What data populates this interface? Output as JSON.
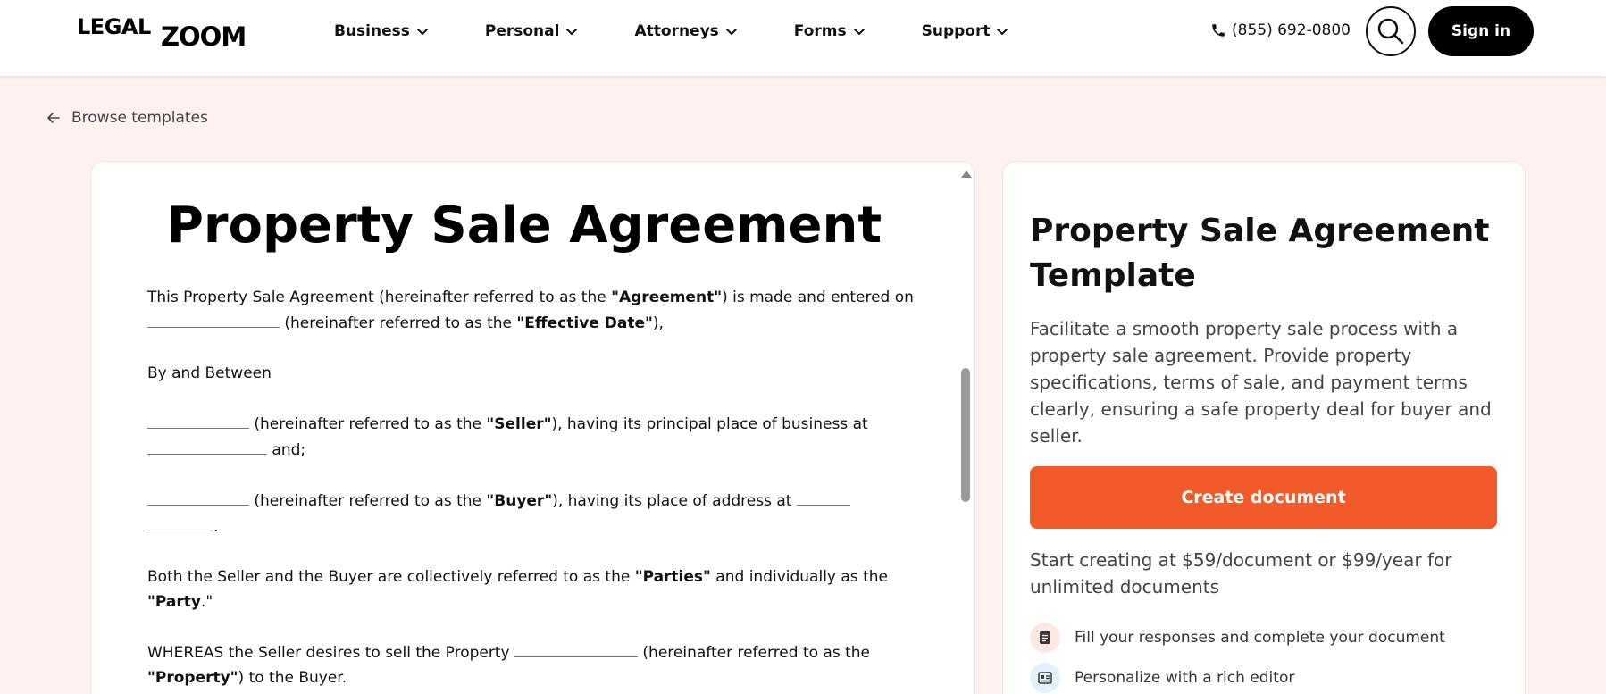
{
  "header": {
    "logo_part1": "LEGAL",
    "logo_part2": "ZOOM",
    "nav": [
      {
        "label": "Business"
      },
      {
        "label": "Personal"
      },
      {
        "label": "Attorneys"
      },
      {
        "label": "Forms"
      },
      {
        "label": "Support"
      }
    ],
    "phone": "(855) 692-0800",
    "sign_in": "Sign in"
  },
  "back_link": "Browse templates",
  "document": {
    "title": "Property Sale Agreement",
    "p1_a": "This Property Sale Agreement (hereinafter referred to as the ",
    "p1_b": "\"Agreement\"",
    "p1_c": ") is made and entered on",
    "p1_d": " (hereinafter referred to as the ",
    "p1_e": "\"Effective Date\"",
    "p1_f": "),",
    "p2": "By and Between",
    "p3_a": " (hereinafter referred to as the ",
    "p3_b": "\"Seller\"",
    "p3_c": "), having its principal place of business at",
    "p3_d": " and;",
    "p4_a": " (hereinafter referred to as the ",
    "p4_b": "\"Buyer\"",
    "p4_c": "), having its place of address at ",
    "p4_d": ".",
    "p5_a": "Both the Seller and the Buyer are collectively referred to as the ",
    "p5_b": "\"Parties\"",
    "p5_c": " and individually as the",
    "p5_d": "\"Party",
    "p5_e": ".\"",
    "p6_a": "WHEREAS the Seller desires to sell the Property ",
    "p6_b": " (hereinafter referred to as the",
    "p6_c": "\"Property\"",
    "p6_d": ") to the Buyer."
  },
  "side": {
    "title": "Property Sale Agreement Template",
    "description": "Facilitate a smooth property sale process with a property sale agreement. Provide property specifications, terms of sale, and payment terms clearly, ensuring a safe property deal for buyer and seller.",
    "cta": "Create document",
    "pricing": "Start creating at $59/document or $99/year for unlimited documents",
    "features": [
      {
        "label": "Fill your responses and complete your document",
        "icon": "document-icon",
        "bg": "#fde9e2"
      },
      {
        "label": "Personalize with a rich editor",
        "icon": "editor-icon",
        "bg": "#e3f1fb"
      }
    ]
  },
  "colors": {
    "accent": "#f25a29",
    "page_bg": "#fdf2ef"
  }
}
